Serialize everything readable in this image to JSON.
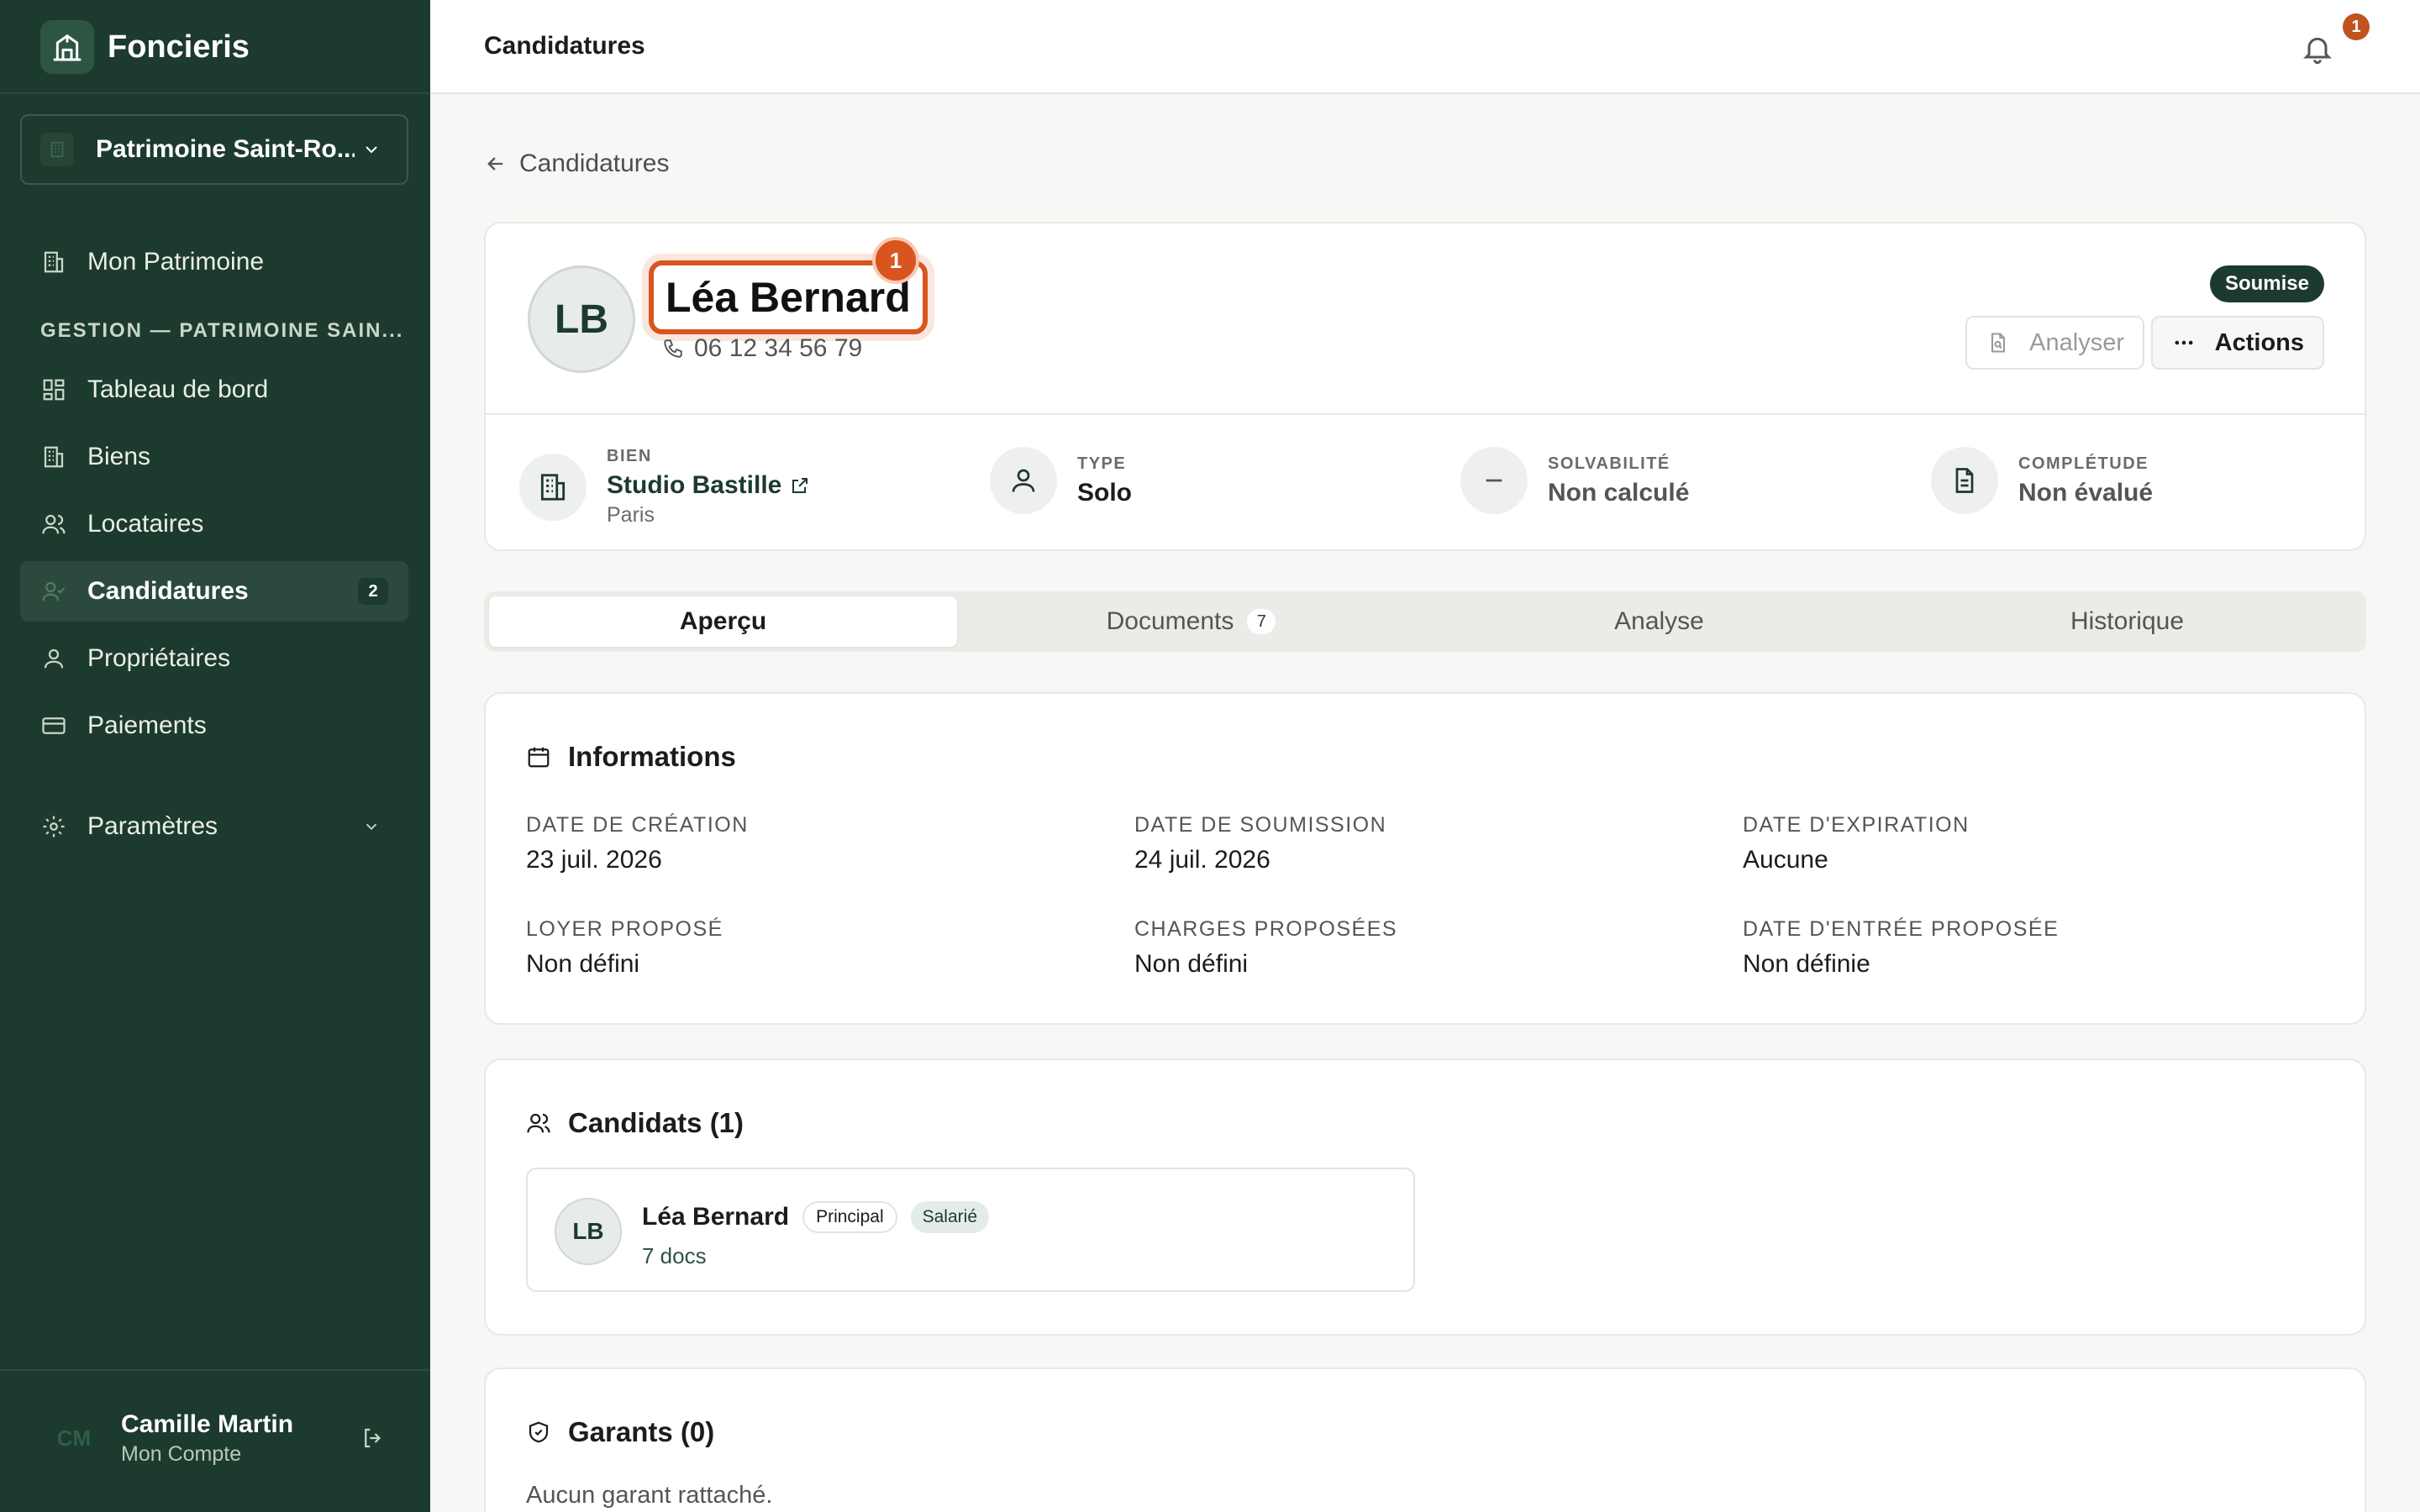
{
  "app": {
    "name": "Foncieris"
  },
  "org_selector": {
    "label": "Patrimoine Saint-Ro..."
  },
  "nav": {
    "top": {
      "label": "Mon Patrimoine"
    },
    "section_label": "GESTION — PATRIMOINE SAIN...",
    "items": [
      {
        "label": "Tableau de bord",
        "icon": "dashboard-icon"
      },
      {
        "label": "Biens",
        "icon": "building-icon"
      },
      {
        "label": "Locataires",
        "icon": "users-icon"
      },
      {
        "label": "Candidatures",
        "icon": "user-check-icon",
        "badge": "2",
        "active": true
      },
      {
        "label": "Propriétaires",
        "icon": "user-icon"
      },
      {
        "label": "Paiements",
        "icon": "card-icon"
      }
    ],
    "settings": {
      "label": "Paramètres"
    }
  },
  "user": {
    "initials": "CM",
    "name": "Camille Martin",
    "subtitle": "Mon Compte"
  },
  "header": {
    "title": "Candidatures",
    "notification_count": "1"
  },
  "back_link": {
    "label": "Candidatures"
  },
  "applicant": {
    "initials": "LB",
    "name": "Léa Bernard",
    "annotation_number": "1",
    "phone": "06 12 34 56 79",
    "status": "Soumise",
    "analyze_label": "Analyser",
    "actions_label": "Actions"
  },
  "stats": {
    "bien": {
      "label": "BIEN",
      "value": "Studio Bastille",
      "sub": "Paris"
    },
    "type": {
      "label": "TYPE",
      "value": "Solo"
    },
    "solvabilite": {
      "label": "SOLVABILITÉ",
      "value": "Non calculé"
    },
    "completude": {
      "label": "COMPLÉTUDE",
      "value": "Non évalué"
    }
  },
  "tabs": [
    {
      "label": "Aperçu",
      "active": true
    },
    {
      "label": "Documents",
      "count": "7"
    },
    {
      "label": "Analyse"
    },
    {
      "label": "Historique"
    }
  ],
  "informations": {
    "title": "Informations",
    "fields": [
      {
        "label": "DATE DE CRÉATION",
        "value": "23 juil. 2026"
      },
      {
        "label": "DATE DE SOUMISSION",
        "value": "24 juil. 2026"
      },
      {
        "label": "DATE D'EXPIRATION",
        "value": "Aucune"
      },
      {
        "label": "LOYER PROPOSÉ",
        "value": "Non défini"
      },
      {
        "label": "CHARGES PROPOSÉES",
        "value": "Non défini"
      },
      {
        "label": "DATE D'ENTRÉE PROPOSÉE",
        "value": "Non définie"
      }
    ]
  },
  "candidats": {
    "title": "Candidats (1)",
    "items": [
      {
        "initials": "LB",
        "name": "Léa Bernard",
        "tag_role": "Principal",
        "tag_status": "Salarié",
        "docs": "7 docs"
      }
    ]
  },
  "garants": {
    "title": "Garants (0)",
    "empty": "Aucun garant rattaché."
  },
  "colors": {
    "sidebar": "#1d3a2e",
    "accent": "#d9541e",
    "background": "#f7f7f5"
  }
}
